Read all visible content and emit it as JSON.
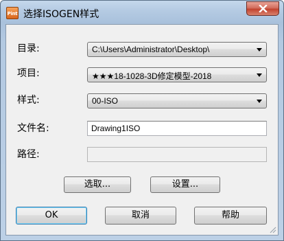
{
  "window": {
    "title": "选择ISOGEN样式",
    "icon_text": "Pint",
    "close_label": "x"
  },
  "fields": {
    "directory": {
      "label": "目录:",
      "value": "C:\\Users\\Administrator\\Desktop\\"
    },
    "project": {
      "label": "项目:",
      "value": "★★★18-1028-3D修定模型-2018"
    },
    "style": {
      "label": "样式:",
      "value": "00-ISO"
    },
    "filename": {
      "label": "文件名:",
      "value": "Drawing1ISO"
    },
    "path": {
      "label": "路径:",
      "value": ""
    }
  },
  "buttons": {
    "select": "选取...",
    "settings": "设置...",
    "ok": "OK",
    "cancel": "取消",
    "help": "帮助"
  },
  "icons": {
    "close": "close-x-icon",
    "dropdown": "chevron-down-icon",
    "resize": "resize-grip-icon",
    "app": "pint-app-icon"
  },
  "colors": {
    "titlebar": "#b5cbe3",
    "client": "#f0f0f0",
    "close_button": "#c2432f",
    "default_button_border": "#3c7fb1"
  }
}
